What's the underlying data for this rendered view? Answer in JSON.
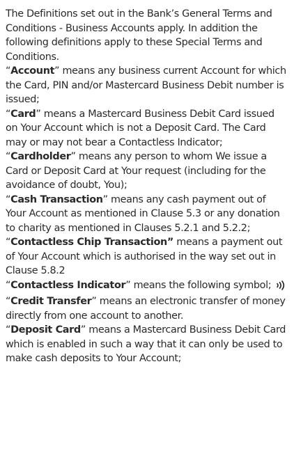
{
  "intro": "The Definitions set out in the Bank’s General Terms and Conditions - Business Accounts apply. In addition the following definitions apply to these Special Terms and Conditions.",
  "definitions": [
    {
      "open": "“",
      "term": "Account",
      "close": "”",
      "text": " means any business current Account for which the Card, PIN and/or Mastercard Business Debit number is issued;"
    },
    {
      "open": "“",
      "term": "Card",
      "close": "”",
      "text": " means a Mastercard Business Debit Card issued on Your Account which is not a Deposit Card. The Card may or may not bear a Contactless Indicator;"
    },
    {
      "open": "“",
      "term": "Cardholder",
      "close": "”",
      "text": " means any person to whom We issue a Card or Deposit Card at Your request (including for the avoidance of doubt, You);"
    },
    {
      "open": "“",
      "term": "Cash Transaction",
      "close": "”",
      "text": " means any cash payment out of Your Account as mentioned in Clause 5.3 or any donation to charity as mentioned in Clauses 5.2.1 and 5.2.2;"
    },
    {
      "open": "“",
      "term": "Contactless Chip Transaction”",
      "close": "",
      "text": " means a payment out of Your Account which is authorised in the way set out in Clause 5.8.2"
    },
    {
      "open": "“",
      "term": "Contactless Indicator",
      "close": "”",
      "text": " means the following symbol;",
      "icon": "contactless-icon"
    },
    {
      "open": "“",
      "term": "Credit Transfer",
      "close": "”",
      "text": " means an electronic transfer of money directly from one account to another."
    },
    {
      "open": "“",
      "term": "Deposit Card",
      "close": "”",
      "text": " means a Mastercard Business Debit Card which is enabled in such a way that it can only be used to make cash deposits to Your Account;"
    }
  ]
}
